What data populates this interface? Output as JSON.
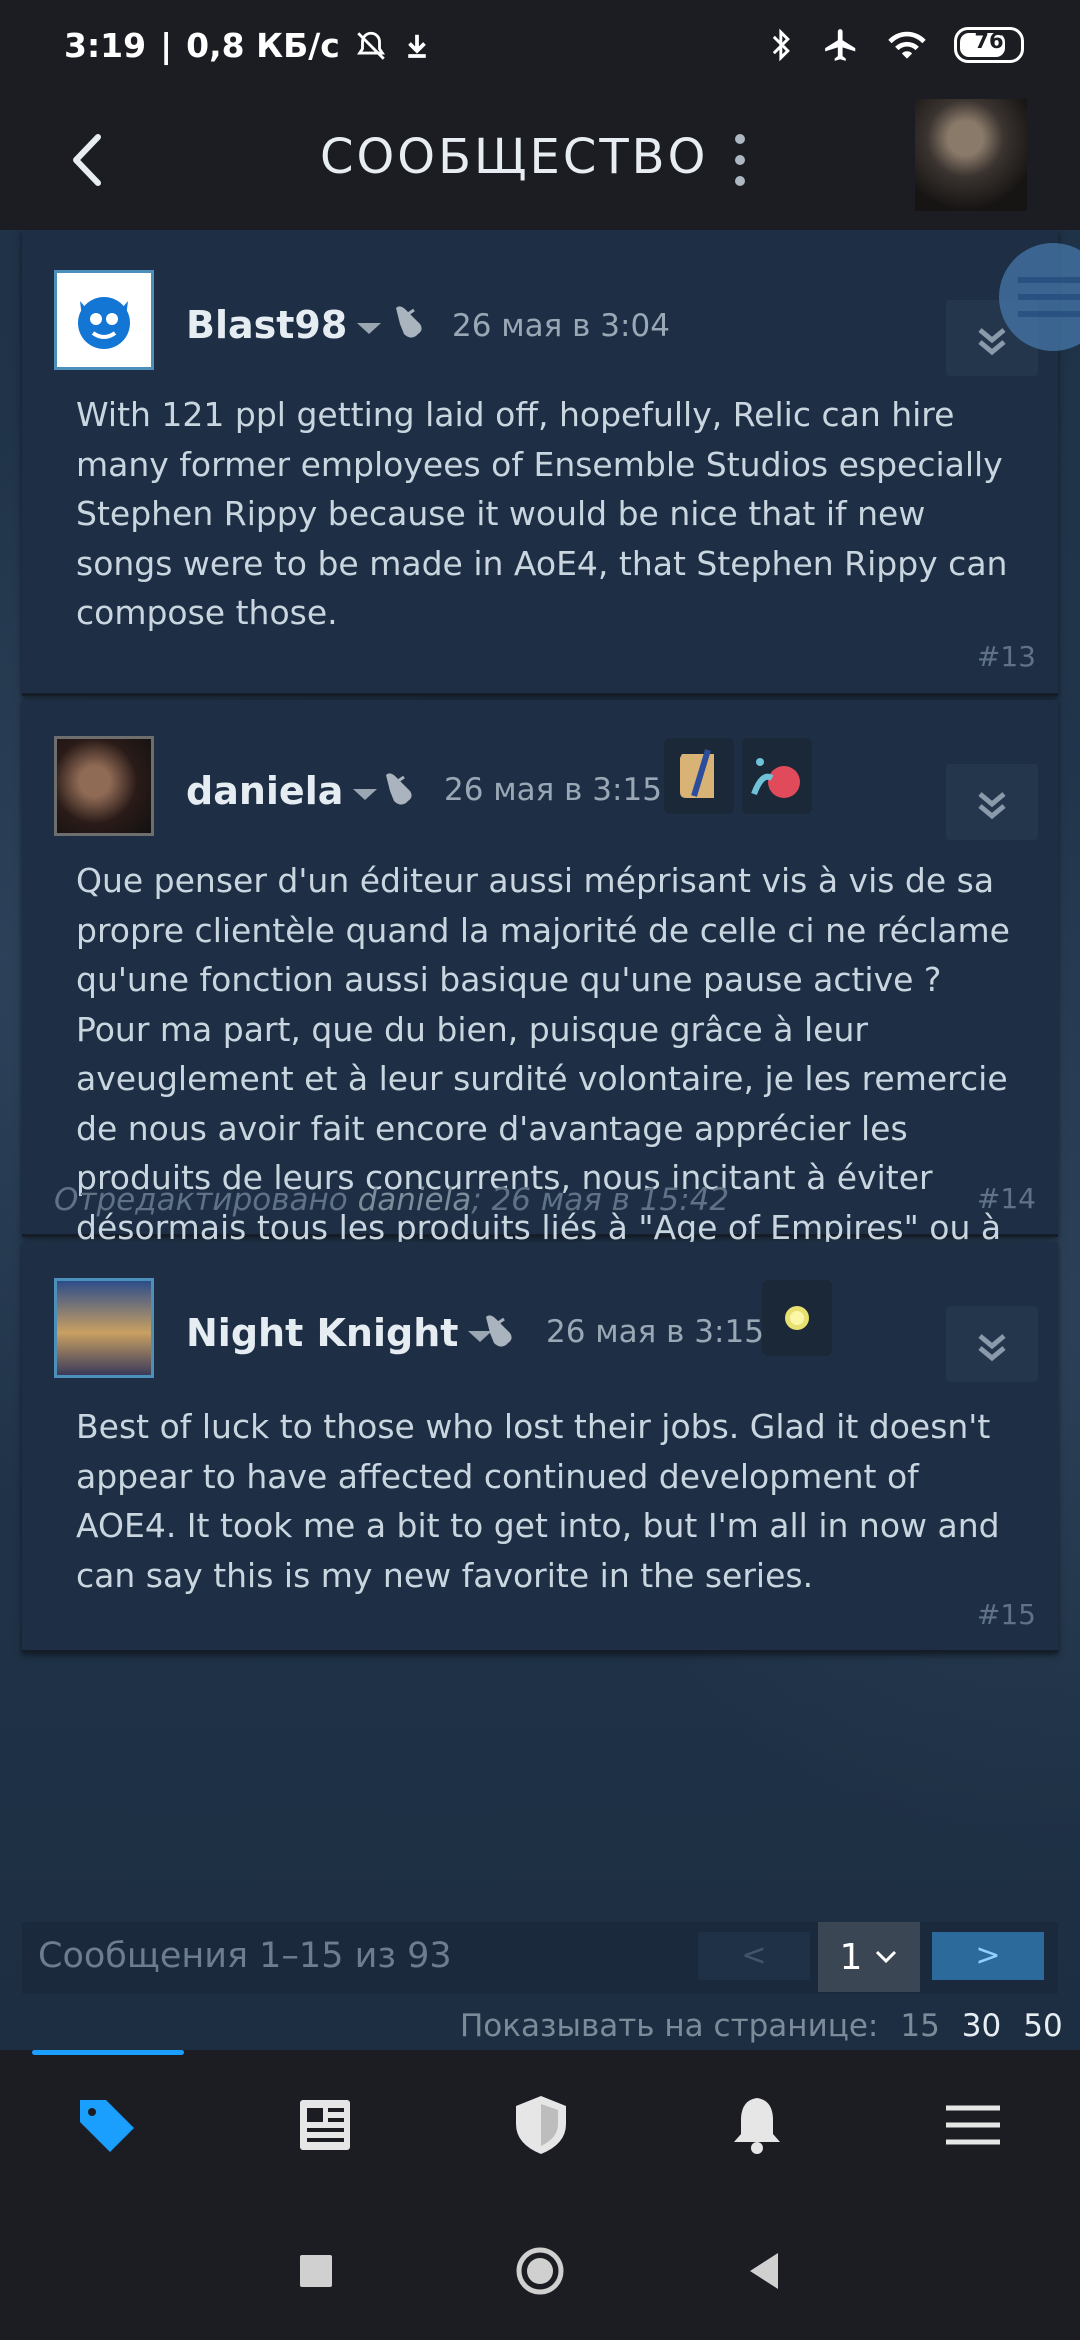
{
  "status_bar": {
    "time": "3:19",
    "speed": "0,8 КБ/с",
    "battery": "76"
  },
  "header": {
    "title": "СООБЩЕСТВО"
  },
  "posts": [
    {
      "author": "Blast98",
      "timestamp": "26 мая в 3:04",
      "text": "With 121 ppl getting laid off, hopefully, Relic can hire many former employees of Ensemble Studios especially Stephen Rippy because it would be nice that if new songs were to be made in AoE4, that Stephen Rippy can compose those.",
      "number": "#13"
    },
    {
      "author": "daniela",
      "timestamp": "26 мая в 3:15",
      "text": "Que penser d'un éditeur aussi méprisant vis à vis de sa propre clientèle quand la majorité de celle ci ne réclame qu'une fonction aussi basique qu'une pause active ? Pour ma part, que du bien, puisque grâce à leur aveuglement et à leur surdité volontaire, je les remercie de nous avoir fait encore d'avantage apprécier les produits de leurs concurrents, nous incitant à éviter désormais tous les produits liés à \"Age of Empires\" ou à Relic et autres géants aux pieds d'argile qui comme leurs camarades de Gaijin ne tarderont pas à boire le bouillon.",
      "edited_prefix": "Отредактировано",
      "edited_by": "daniela",
      "edited_date": "; 26 мая в 15:42",
      "number": "#14"
    },
    {
      "author": "Night Knight",
      "timestamp": "26 мая в 3:15",
      "text": "Best of luck to those who lost their jobs. Glad it doesn't appear to have affected continued development of AOE4. It took me a bit to get into, but I'm all in now and can say this is my new favorite in the series.",
      "number": "#15"
    }
  ],
  "pagination": {
    "summary": "Сообщения 1–15 из 93",
    "prev": "<",
    "current_page": "1",
    "next": ">",
    "per_page_label": "Показывать на странице:",
    "per_page_options": [
      "15",
      "30",
      "50"
    ]
  },
  "colors": {
    "accent": "#1a9fff",
    "background": "#1b1d22",
    "post_bg": "#1e2f45"
  },
  "icons": {
    "nav": [
      "tag-icon",
      "news-icon",
      "shield-icon",
      "bell-icon",
      "menu-icon"
    ],
    "system": [
      "square-icon",
      "circle-icon",
      "triangle-back-icon"
    ]
  }
}
